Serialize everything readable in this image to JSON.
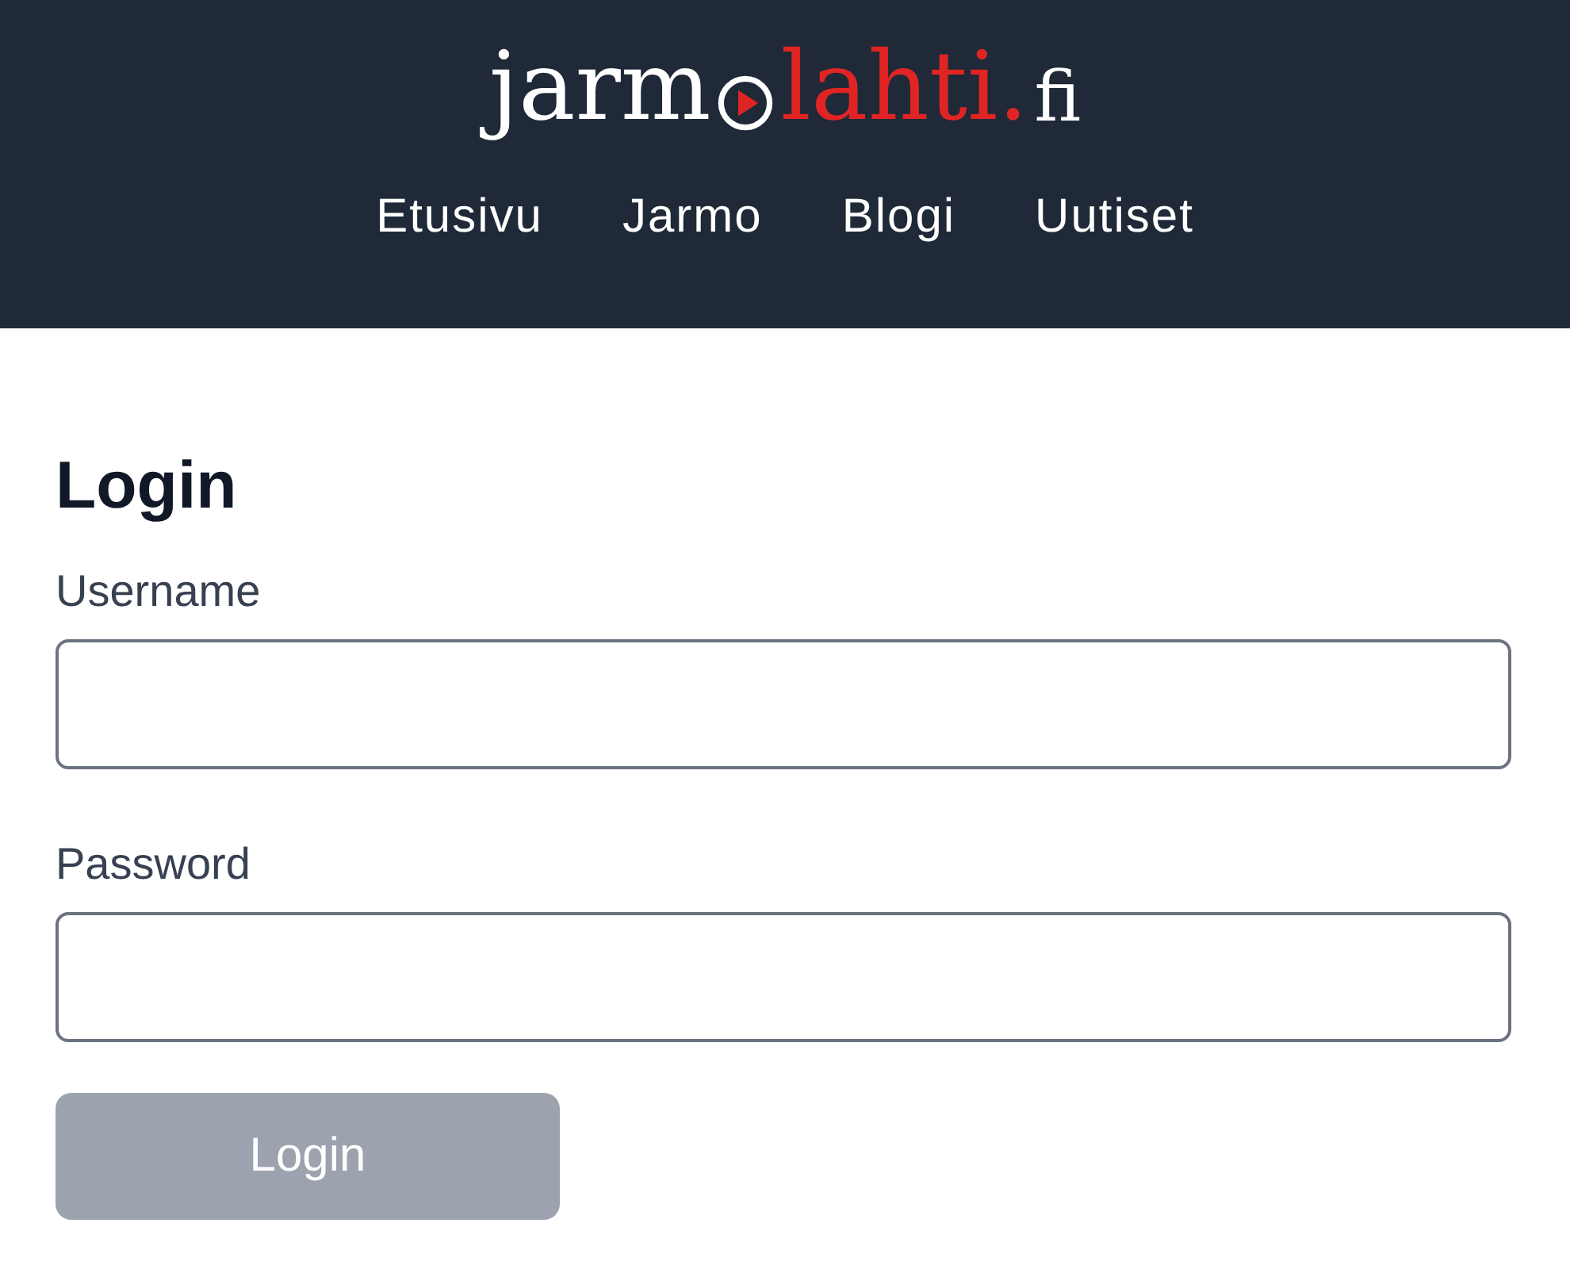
{
  "logo": {
    "text_before": "jarm",
    "text_accent": "lahti.",
    "text_after": "fi"
  },
  "nav": [
    {
      "label": "Etusivu"
    },
    {
      "label": "Jarmo"
    },
    {
      "label": "Blogi"
    },
    {
      "label": "Uutiset"
    }
  ],
  "heading": "Login",
  "fields": [
    {
      "label": "Username"
    },
    {
      "label": "Password"
    }
  ],
  "submit": {
    "label": "Login",
    "disabled": true
  }
}
